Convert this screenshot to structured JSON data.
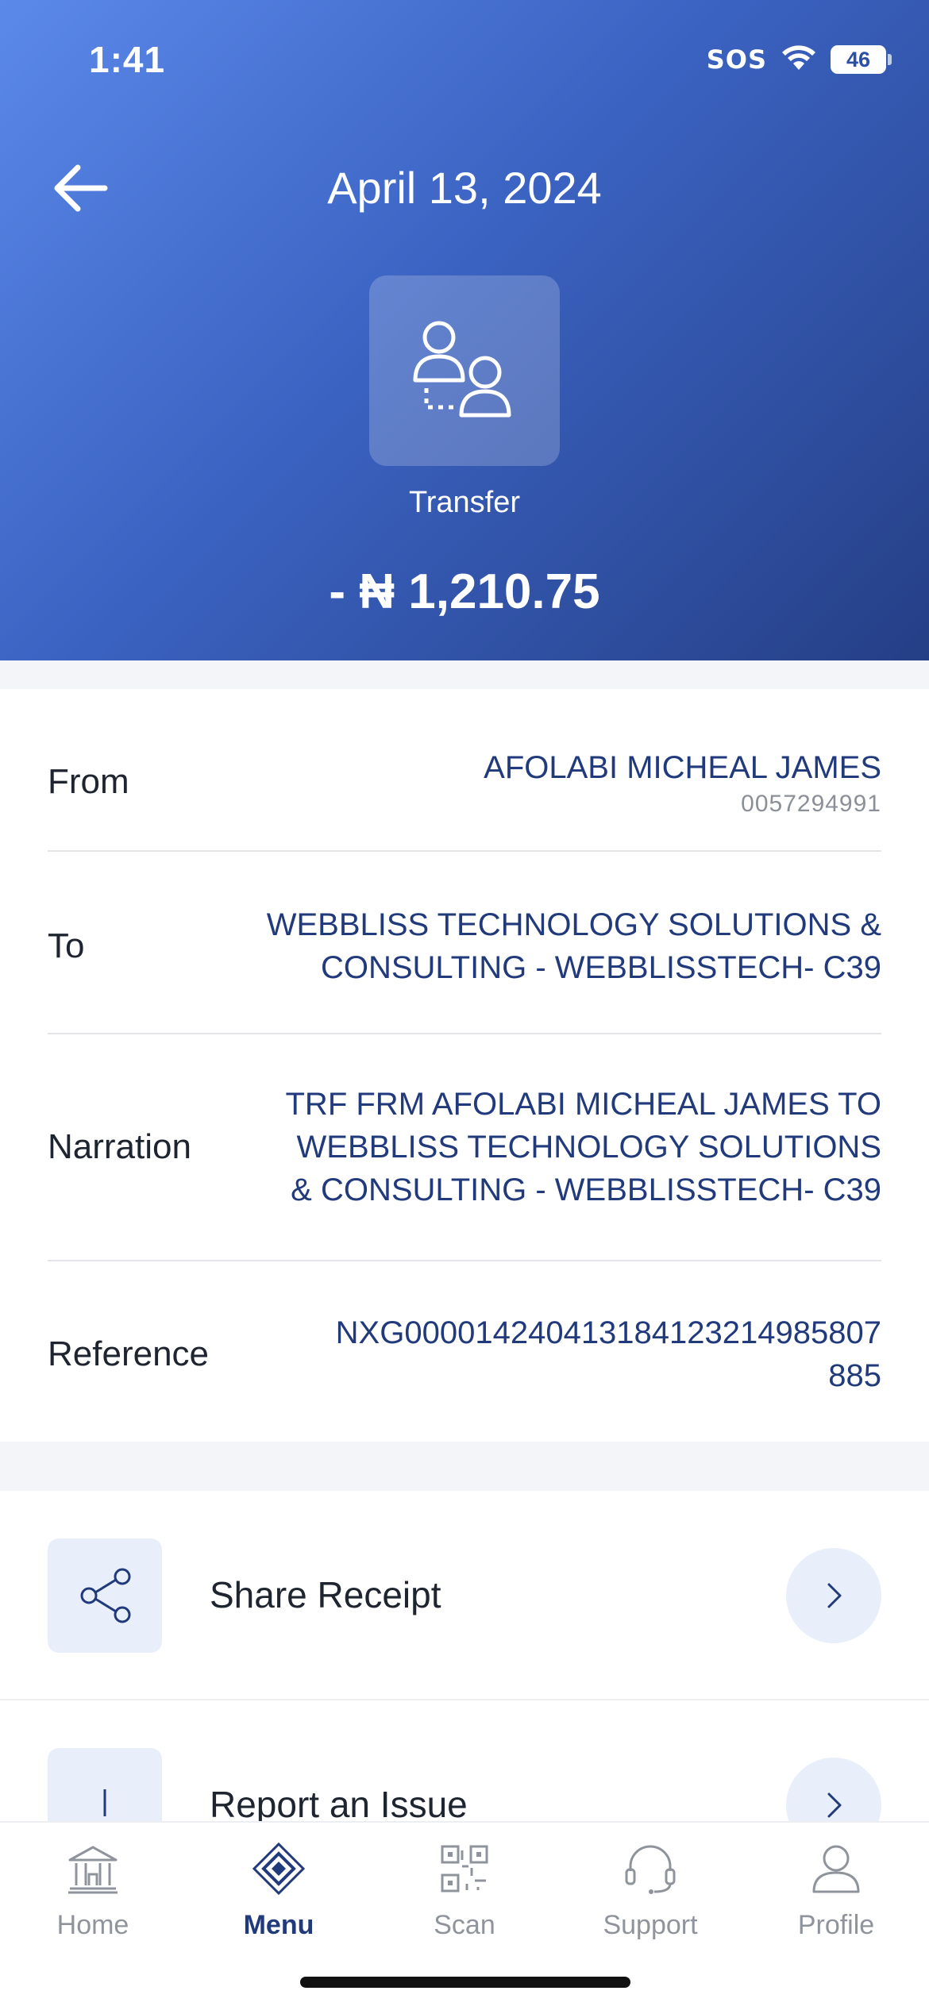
{
  "status_bar": {
    "time": "1:41",
    "carrier": "SOS",
    "battery": "46"
  },
  "header": {
    "title": "April 13, 2024",
    "transaction_type": "Transfer",
    "amount": "- ₦ 1,210.75"
  },
  "details": {
    "from": {
      "label": "From",
      "name": "AFOLABI MICHEAL JAMES",
      "account": "0057294991"
    },
    "to": {
      "label": "To",
      "line1": "WEBBLISS TECHNOLOGY SOLUTIONS &",
      "line2": "CONSULTING - WEBBLISSTECH- C39"
    },
    "narration": {
      "label": "Narration",
      "line1": "TRF FRM AFOLABI MICHEAL JAMES TO",
      "line2": "WEBBLISS TECHNOLOGY SOLUTIONS",
      "line3": "& CONSULTING - WEBBLISSTECH- C39"
    },
    "reference": {
      "label": "Reference",
      "line1": "NXG0000142404131841232149858​07",
      "line2": "885"
    }
  },
  "actions": {
    "share": "Share Receipt",
    "report": "Report an Issue"
  },
  "tabs": [
    {
      "label": "Home",
      "icon": "bank-icon"
    },
    {
      "label": "Menu",
      "icon": "diamond-menu-icon",
      "active": true
    },
    {
      "label": "Scan",
      "icon": "qr-scan-icon"
    },
    {
      "label": "Support",
      "icon": "headset-icon"
    },
    {
      "label": "Profile",
      "icon": "user-icon"
    }
  ],
  "colors": {
    "header_start": "#5b89ea",
    "header_end": "#253f86",
    "accent": "#213a7c"
  }
}
